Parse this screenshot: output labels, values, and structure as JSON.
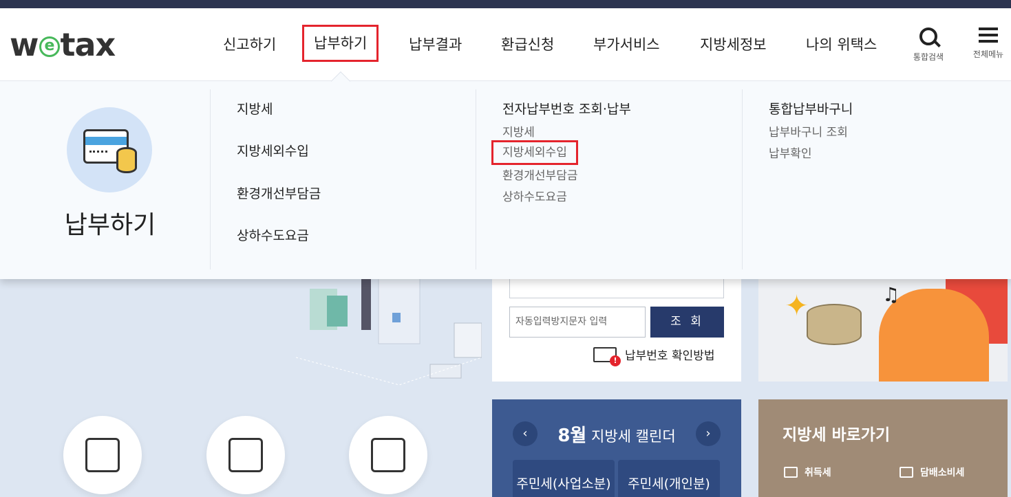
{
  "logo": {
    "text_w": "w",
    "text_e": "e",
    "text_rest": "tax"
  },
  "nav": {
    "items": [
      {
        "label": "신고하기"
      },
      {
        "label": "납부하기"
      },
      {
        "label": "납부결과"
      },
      {
        "label": "환급신청"
      },
      {
        "label": "부가서비스"
      },
      {
        "label": "지방세정보"
      },
      {
        "label": "나의 위택스"
      }
    ],
    "search_label": "통합검색",
    "menu_label": "전체메뉴"
  },
  "mega": {
    "title": "납부하기",
    "col1": [
      "지방세",
      "지방세외수입",
      "환경개선부담금",
      "상하수도요금"
    ],
    "col2": {
      "heading": "전자납부번호 조회·납부",
      "items": [
        "지방세",
        "지방세외수입",
        "환경개선부담금",
        "상하수도요금"
      ]
    },
    "col3": {
      "heading": "통합납부바구니",
      "items": [
        "납부바구니 조회",
        "납부확인"
      ]
    }
  },
  "lookup": {
    "captcha_placeholder": "자동입력방지문자 입력",
    "lookup_button": "조 회",
    "howto_label": "납부번호 확인방법"
  },
  "calendar": {
    "month": "8월",
    "title": "지방세 캘린더",
    "tabs": [
      "주민세(사업소분)",
      "주민세(개인분)"
    ]
  },
  "shortcut": {
    "title": "지방세 바로가기",
    "items": [
      "취득세",
      "담배소비세"
    ]
  },
  "colors": {
    "accent_red": "#e4242d",
    "navy": "#273a6b",
    "calendar_bg": "#3d5a91",
    "shortcut_bg": "#a08b76",
    "logo_green": "#47b85a"
  }
}
